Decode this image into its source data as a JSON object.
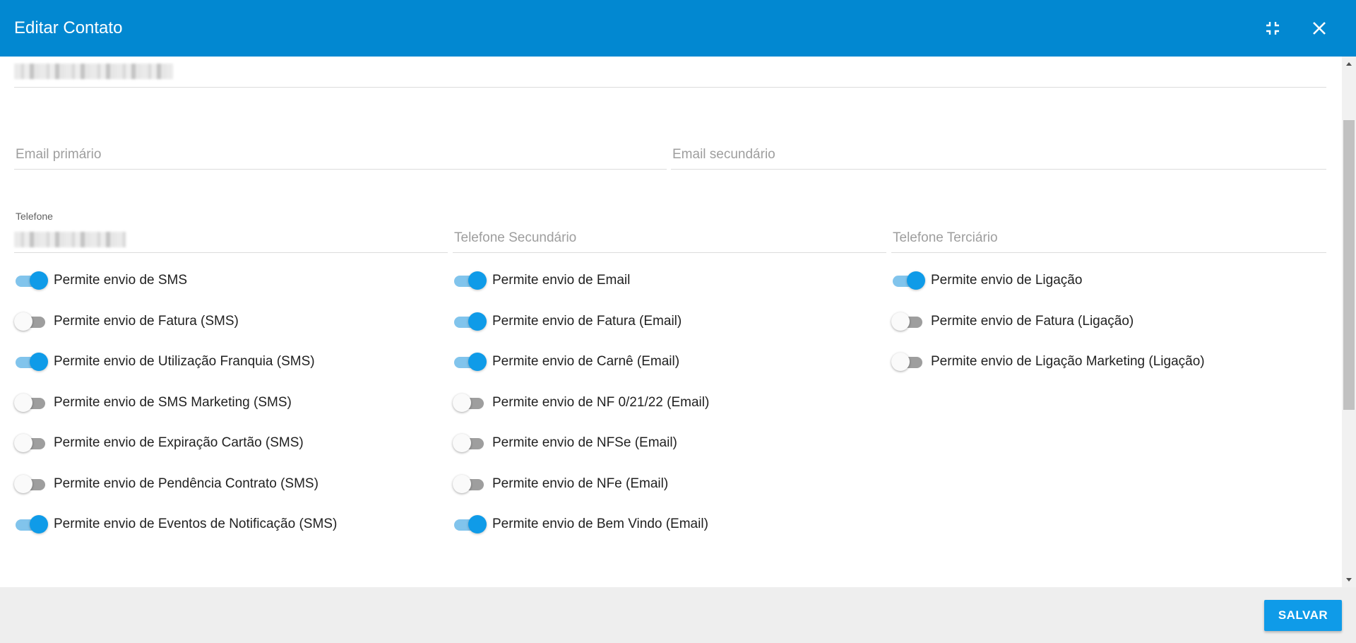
{
  "dialog": {
    "title": "Editar Contato",
    "minimize_icon": "fullscreen-exit-icon",
    "close_icon": "close-icon"
  },
  "form": {
    "email_primary_placeholder": "Email primário",
    "email_secondary_placeholder": "Email secundário",
    "phone_label": "Telefone",
    "phone_secondary_placeholder": "Telefone Secundário",
    "phone_tertiary_placeholder": "Telefone Terciário"
  },
  "toggles": {
    "col1": [
      {
        "label": "Permite envio de SMS",
        "on": true
      },
      {
        "label": "Permite envio de Fatura (SMS)",
        "on": false
      },
      {
        "label": "Permite envio de Utilização Franquia (SMS)",
        "on": true
      },
      {
        "label": "Permite envio de SMS Marketing (SMS)",
        "on": false
      },
      {
        "label": "Permite envio de Expiração Cartão (SMS)",
        "on": false
      },
      {
        "label": "Permite envio de Pendência Contrato (SMS)",
        "on": false
      },
      {
        "label": "Permite envio de Eventos de Notificação (SMS)",
        "on": true
      }
    ],
    "col2": [
      {
        "label": "Permite envio de Email",
        "on": true
      },
      {
        "label": "Permite envio de Fatura (Email)",
        "on": true
      },
      {
        "label": "Permite envio de Carnê (Email)",
        "on": true
      },
      {
        "label": "Permite envio de NF 0/21/22 (Email)",
        "on": false
      },
      {
        "label": "Permite envio de NFSe (Email)",
        "on": false
      },
      {
        "label": "Permite envio de NFe (Email)",
        "on": false
      },
      {
        "label": "Permite envio de Bem Vindo (Email)",
        "on": true
      }
    ],
    "col3": [
      {
        "label": "Permite envio de Ligação",
        "on": true
      },
      {
        "label": "Permite envio de Fatura (Ligação)",
        "on": false
      },
      {
        "label": "Permite envio de Ligação Marketing (Ligação)",
        "on": false
      }
    ]
  },
  "footer": {
    "save_label": "SALVAR"
  },
  "colors": {
    "header": "#0288d1",
    "accent": "#0f9be8",
    "footer_bg": "#eeeeee"
  }
}
